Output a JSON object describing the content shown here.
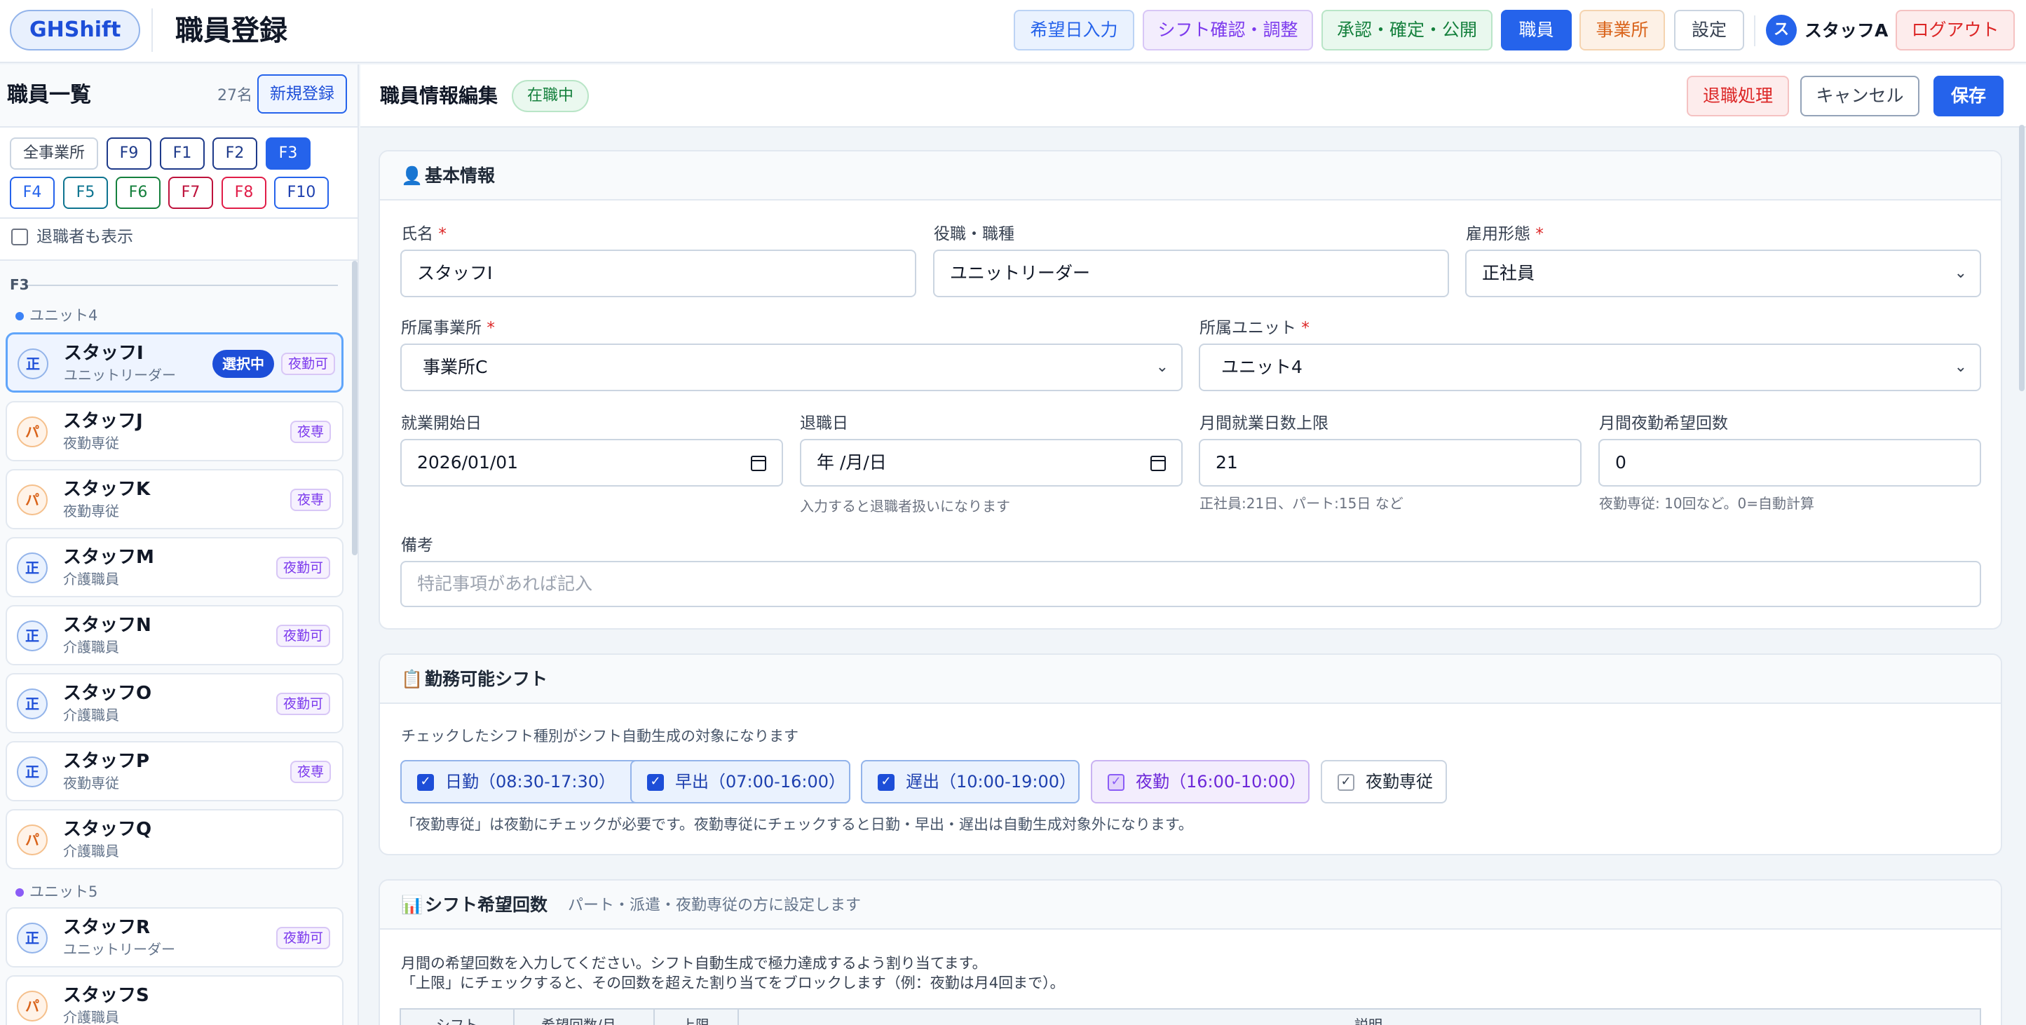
{
  "header": {
    "logo": "GHShift",
    "title": "職員登録",
    "nav": {
      "wish": "希望日入力",
      "shift": "シフト確認・調整",
      "approve": "承認・確定・公開",
      "staff": "職員",
      "office": "事業所",
      "settings": "設定"
    },
    "user_initial": "ス",
    "user_name": "スタッフA",
    "logout": "ログアウト"
  },
  "sidebar": {
    "title": "職員一覧",
    "count": "27名",
    "new_button": "新規登録",
    "filters": [
      "全事業所",
      "F9",
      "F1",
      "F2",
      "F3",
      "F4",
      "F5",
      "F6",
      "F7",
      "F8",
      "F10"
    ],
    "active_filter": "F3",
    "show_retired_label": "退職者も表示",
    "group": "F3",
    "units": {
      "u4": "ユニット4",
      "u5": "ユニット5"
    },
    "staff": [
      {
        "badge": "正",
        "name": "スタッフI",
        "role": "ユニットリーダー",
        "selected_label": "選択中",
        "tag": "夜勤可"
      },
      {
        "badge": "パ",
        "name": "スタッフJ",
        "role": "夜勤専従",
        "tag": "夜専"
      },
      {
        "badge": "パ",
        "name": "スタッフK",
        "role": "夜勤専従",
        "tag": "夜専"
      },
      {
        "badge": "正",
        "name": "スタッフM",
        "role": "介護職員",
        "tag": "夜勤可"
      },
      {
        "badge": "正",
        "name": "スタッフN",
        "role": "介護職員",
        "tag": "夜勤可"
      },
      {
        "badge": "正",
        "name": "スタッフO",
        "role": "介護職員",
        "tag": "夜勤可"
      },
      {
        "badge": "正",
        "name": "スタッフP",
        "role": "夜勤専従",
        "tag": "夜専"
      },
      {
        "badge": "パ",
        "name": "スタッフQ",
        "role": "介護職員",
        "tag": ""
      },
      {
        "badge": "正",
        "name": "スタッフR",
        "role": "ユニットリーダー",
        "tag": "夜勤可"
      },
      {
        "badge": "パ",
        "name": "スタッフS",
        "role": "介護職員",
        "tag": ""
      }
    ]
  },
  "main": {
    "edit_title": "職員情報編集",
    "status": "在職中",
    "retire_button": "退職処理",
    "cancel_button": "キャンセル",
    "save_button": "保存",
    "basic": {
      "title": "基本情報",
      "name_label": "氏名",
      "name_value": "スタッフI",
      "role_label": "役職・職種",
      "role_value": "ユニットリーダー",
      "employment_label": "雇用形態",
      "employment_value": "正社員",
      "office_label": "所属事業所",
      "office_value": "事業所C",
      "unit_label": "所属ユニット",
      "unit_value": "ユニット4",
      "start_label": "就業開始日",
      "start_value": "2026/01/01",
      "end_label": "退職日",
      "end_value": "年 /月/日",
      "end_hint": "入力すると退職者扱いになります",
      "max_days_label": "月間就業日数上限",
      "max_days_value": "21",
      "max_days_hint": "正社員:21日、パート:15日 など",
      "night_label": "月間夜勤希望回数",
      "night_value": "0",
      "night_hint": "夜勤専従: 10回など。0=自動計算",
      "notes_label": "備考",
      "notes_placeholder": "特記事項があれば記入"
    },
    "shifts": {
      "title": "勤務可能シフト",
      "desc": "チェックしたシフト種別がシフト自動生成の対象になります",
      "items": [
        "日勤（08:30-17:30）",
        "早出（07:00-16:00）",
        "遅出（10:00-19:00）",
        "夜勤（16:00-10:00）",
        "夜勤専従"
      ],
      "note": "「夜勤専従」は夜勤にチェックが必要です。夜勤専従にチェックすると日勤・早出・遅出は自動生成対象外になります。"
    },
    "wishcount": {
      "title": "シフト希望回数",
      "sub": "パート・派遣・夜勤専従の方に設定します",
      "desc1": "月間の希望回数を入力してください。シフト自動生成で極力達成するよう割り当てます。",
      "desc2": "「上限」にチェックすると、その回数を超えた割り当てをブロックします（例：夜勤は月4回まで）。",
      "headers": [
        "シフト",
        "希望回数/月",
        "上限",
        "説明"
      ]
    }
  }
}
